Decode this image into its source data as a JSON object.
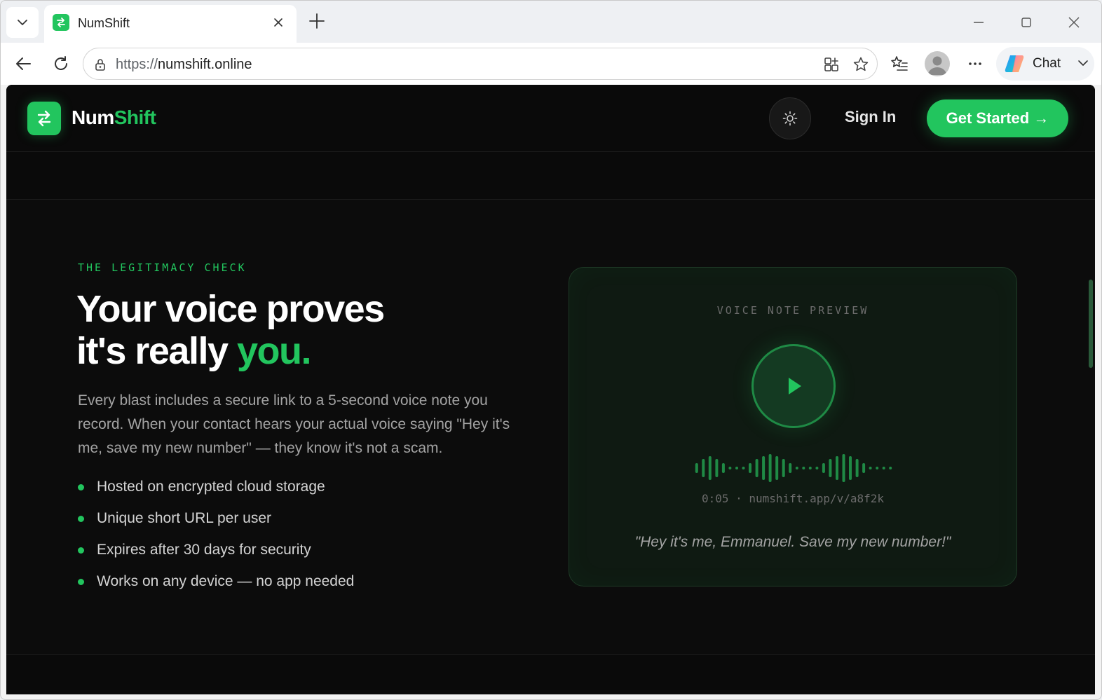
{
  "browser": {
    "tab_title": "NumShift",
    "url_scheme": "https://",
    "url_host": "numshift.online",
    "chat_label": "Chat"
  },
  "site": {
    "logo_num": "Num",
    "logo_shift": "Shift",
    "sign_in": "Sign In",
    "get_started": "Get Started →"
  },
  "section": {
    "eyebrow": "THE LEGITIMACY CHECK",
    "headline_line1": "Your voice proves",
    "headline_line2": "it's really ",
    "headline_accent": "you.",
    "body": "Every blast includes a secure link to a 5-second voice note you record. When your contact hears your actual voice saying \"Hey it's me, save my new number\" — they know it's not a scam.",
    "bullets": [
      "Hosted on encrypted cloud storage",
      "Unique short URL per user",
      "Expires after 30 days for security",
      "Works on any device — no app needed"
    ]
  },
  "voice_note": {
    "label": "VOICE NOTE PREVIEW",
    "meta": "0:05 · numshift.app/v/a8f2k",
    "quote": "\"Hey it's me, Emmanuel. Save my new number!\""
  },
  "colors": {
    "accent": "#22c55e",
    "background": "#0c0c0c"
  },
  "icons": {
    "tab_menu": "chevron-down-icon",
    "favicon": "swap-arrows-icon",
    "back": "back-arrow-icon",
    "reload": "reload-icon",
    "lock": "lock-icon",
    "theme": "sun-icon",
    "play": "play-icon"
  }
}
